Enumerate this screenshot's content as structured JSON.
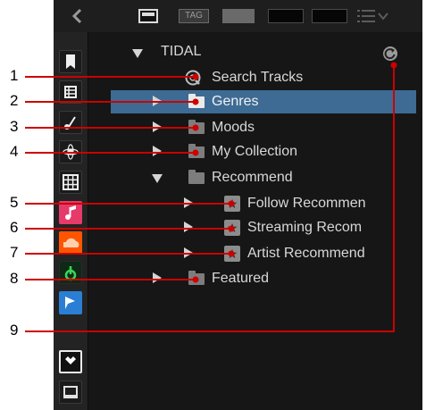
{
  "tree": {
    "root": "TIDAL",
    "items": [
      {
        "label": "Search Tracks"
      },
      {
        "label": "Genres"
      },
      {
        "label": "Moods"
      },
      {
        "label": "My Collection"
      },
      {
        "label": "Recommend"
      },
      {
        "label": "Follow Recommen"
      },
      {
        "label": "Streaming Recom"
      },
      {
        "label": "Artist Recommend"
      },
      {
        "label": "Featured"
      }
    ]
  },
  "topbar": {
    "tag_label": "TAG"
  },
  "callouts": [
    "1",
    "2",
    "3",
    "4",
    "5",
    "6",
    "7",
    "8",
    "9"
  ],
  "colors": {
    "selection": "#3d6b94",
    "callout_line": "#cc0000"
  },
  "icons": [
    "bookmark-icon",
    "list-view-icon",
    "music-note-icon",
    "browser-icon",
    "grid-icon",
    "itunes-icon",
    "soundcloud-icon",
    "beatport-icon",
    "tidal-icon",
    "tidal-logo-icon",
    "computer-icon"
  ]
}
